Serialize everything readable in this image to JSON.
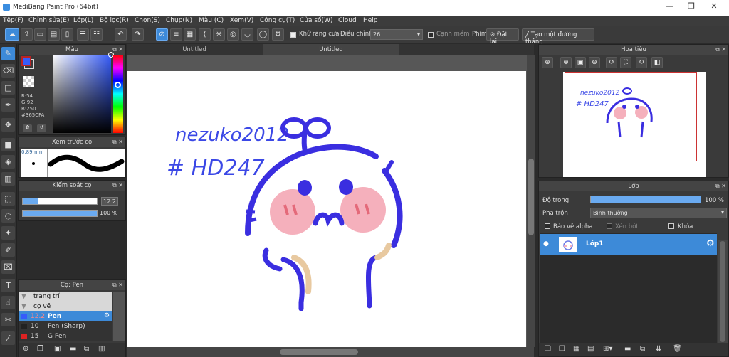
{
  "window": {
    "title": "MediBang Paint Pro (64bit)",
    "minimize": "—",
    "maximize": "❐",
    "close": "✕"
  },
  "menu": [
    "Tệp(F)",
    "Chỉnh sửa(E)",
    "Lớp(L)",
    "Bộ lọc(R)",
    "Chọn(S)",
    "Chụp(N)",
    "Màu (C)",
    "Xem(V)",
    "Công cụ(T)",
    "Cửa số(W)",
    "Cloud",
    "Help"
  ],
  "toolbar": {
    "antialias_label": "Khử răng cưa",
    "adjust_label": "Điều chỉnh",
    "adjust_value": "26",
    "soft_edge_label": "Cạnh mềm",
    "keys_label": "Phím",
    "reset_label": "Đặt lại",
    "straight_line_label": "Tạo một đường thẳng"
  },
  "color_panel": {
    "title": "Màu",
    "r": "R:54",
    "g": "G:92",
    "b": "B:250",
    "hex": "#365CFA",
    "fg": "#365cfa",
    "bg": "#ffffff"
  },
  "brush_preview": {
    "title": "Xem trước cọ",
    "size": "0.89mm"
  },
  "brush_control": {
    "title": "Kiểm soát cọ",
    "size_value": "12.2",
    "opacity_value": "100 %",
    "size_fraction": 0.2,
    "opacity_fraction": 1.0
  },
  "brush_list": {
    "title": "Cọ: Pen",
    "groups": [
      {
        "label": "trang trí"
      },
      {
        "label": "cọ vẽ"
      }
    ],
    "items": [
      {
        "size": "12.2",
        "name": "Pen",
        "color": "#365cfa",
        "selected": true
      },
      {
        "size": "10",
        "name": "Pen (Sharp)",
        "color": "#222222",
        "selected": false
      },
      {
        "size": "15",
        "name": "G Pen",
        "color": "#dd2222",
        "selected": false
      }
    ]
  },
  "tabs": [
    "Untitled",
    "Untitled"
  ],
  "canvas_text": {
    "line1": "nezuko2012",
    "line2": "# HD247"
  },
  "navigator": {
    "title": "Hoa tiêu"
  },
  "layer_panel": {
    "title": "Lớp",
    "opacity_label": "Độ trong",
    "opacity_value": "100 %",
    "opacity_fraction": 1.0,
    "blend_label": "Pha trộn",
    "blend_value": "Bình thường",
    "protect_alpha": "Bảo vệ alpha",
    "clipping": "Xén bớt",
    "lock": "Khóa",
    "layers": [
      {
        "name": "Lớp1"
      }
    ]
  }
}
